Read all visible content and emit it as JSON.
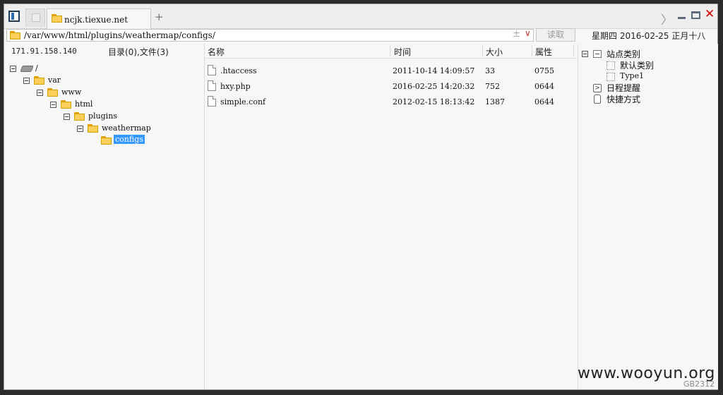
{
  "tabs": [
    {
      "label": ""
    },
    {
      "label": "ncjk.tiexue.net"
    }
  ],
  "new_tab_symbol": "+",
  "window_controls": {
    "nav_glyph": "〉",
    "close_glyph": "✕"
  },
  "address": {
    "path": "/var/www/html/plugins/weathermap/configs/",
    "up_glyph": "±",
    "dropdown_glyph": "∨"
  },
  "read_button": "读取",
  "calendar_line": "星期四  2016-02-25  正月十八",
  "left": {
    "ip": "171.91.158.140",
    "counts": "目录(0),文件(3)",
    "tree": [
      {
        "label": "/",
        "kind": "drive",
        "depth": 0
      },
      {
        "label": "var",
        "kind": "folder",
        "depth": 1
      },
      {
        "label": "www",
        "kind": "folder",
        "depth": 2
      },
      {
        "label": "html",
        "kind": "folder",
        "depth": 3
      },
      {
        "label": "plugins",
        "kind": "folder",
        "depth": 4
      },
      {
        "label": "weathermap",
        "kind": "folder",
        "depth": 5
      },
      {
        "label": "configs",
        "kind": "folder",
        "depth": 6,
        "selected": true
      }
    ]
  },
  "list": {
    "columns": [
      "名称",
      "时间",
      "大小",
      "属性"
    ],
    "files": [
      {
        "name": ".htaccess",
        "time": "2011-10-14 14:09:57",
        "size": "33",
        "perm": "0755"
      },
      {
        "name": "hxy.php",
        "time": "2016-02-25 14:20:32",
        "size": "752",
        "perm": "0644"
      },
      {
        "name": "simple.conf",
        "time": "2012-02-15 18:13:42",
        "size": "1387",
        "perm": "0644"
      }
    ]
  },
  "right": {
    "site_types": "站点类别",
    "default_type": "默认类别",
    "type1": "Type1",
    "schedule": "日程提醒",
    "shortcuts": "快捷方式"
  },
  "watermark": "www.wooyun.org",
  "encoding": "GB2312"
}
